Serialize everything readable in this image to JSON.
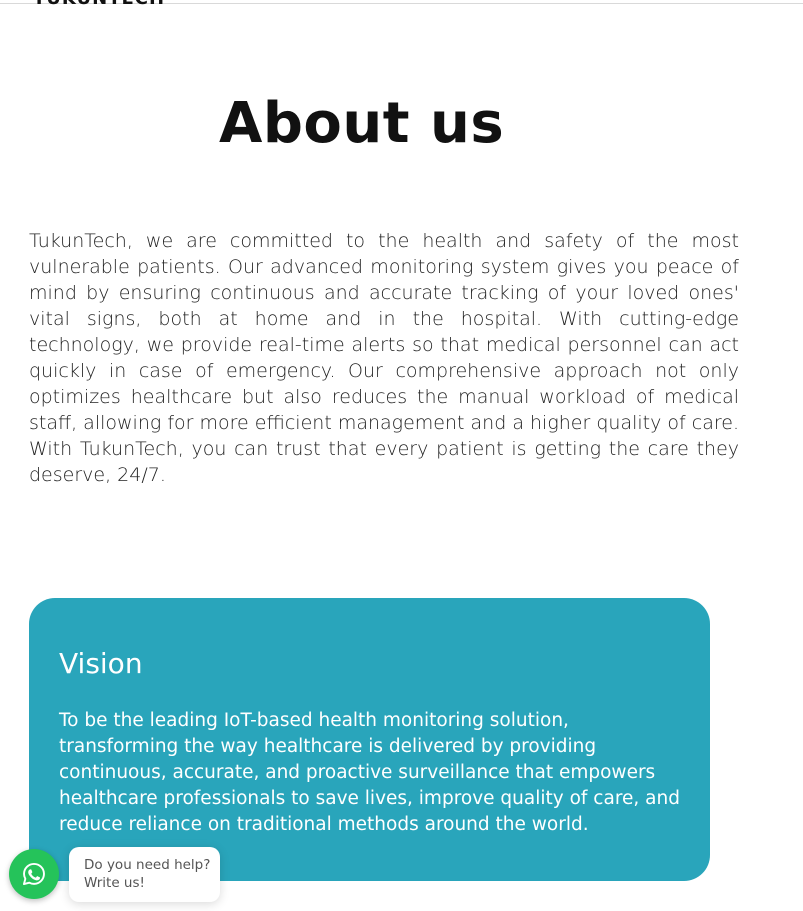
{
  "header": {
    "logo_text": "TUKUNTECH"
  },
  "about": {
    "title": "About us",
    "body": "TukunTech, we are committed to the health and safety of the most vulnerable patients. Our advanced monitoring system gives you peace of mind by ensuring continuous and accurate tracking of your loved ones' vital signs, both at home and in the hospital. With cutting-edge technology, we provide real-time alerts so that medical personnel can act quickly in case of emergency. Our comprehensive approach not only optimizes healthcare but also reduces the manual workload of medical staff, allowing for more efficient management and a higher quality of care. With TukunTech, you can trust that every patient is getting the care they deserve, 24/7."
  },
  "vision": {
    "title": "Vision",
    "body": "To be the leading IoT-based health monitoring solution, transforming the way healthcare is delivered by providing continuous, accurate, and proactive surveillance that empowers healthcare professionals to save lives, improve quality of care, and reduce reliance on traditional methods around the world."
  },
  "chat_widget": {
    "icon": "whatsapp-icon",
    "line1": "Do you need help?",
    "line2": "Write us!"
  },
  "colors": {
    "vision_card": "#29a5bb",
    "whatsapp_green": "#25c35a"
  }
}
